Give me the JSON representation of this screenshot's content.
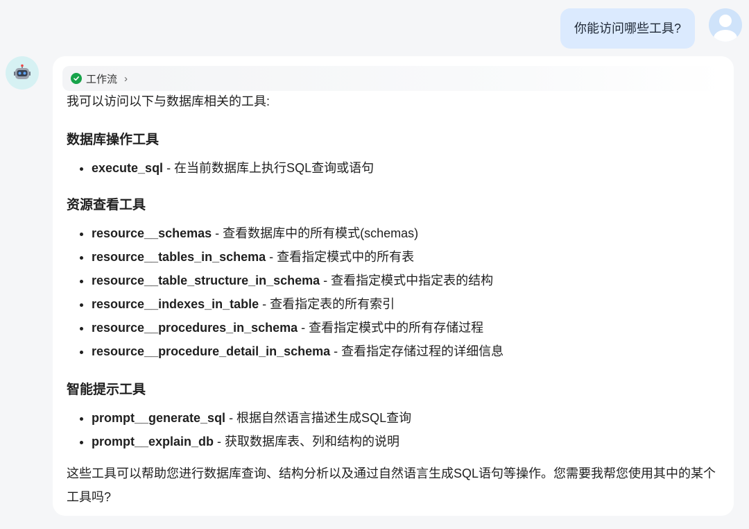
{
  "user_message": "你能访问哪些工具?",
  "workflow_label": "工作流",
  "intro": "我可以访问以下与数据库相关的工具:",
  "sections": [
    {
      "title": "数据库操作工具",
      "items": [
        {
          "name": "execute_sql",
          "desc": " - 在当前数据库上执行SQL查询或语句"
        }
      ]
    },
    {
      "title": "资源查看工具",
      "items": [
        {
          "name": "resource__schemas",
          "desc": " - 查看数据库中的所有模式(schemas)"
        },
        {
          "name": "resource__tables_in_schema",
          "desc": " - 查看指定模式中的所有表"
        },
        {
          "name": "resource__table_structure_in_schema",
          "desc": " - 查看指定模式中指定表的结构"
        },
        {
          "name": "resource__indexes_in_table",
          "desc": " - 查看指定表的所有索引"
        },
        {
          "name": "resource__procedures_in_schema",
          "desc": " - 查看指定模式中的所有存储过程"
        },
        {
          "name": "resource__procedure_detail_in_schema",
          "desc": " - 查看指定存储过程的详细信息"
        }
      ]
    },
    {
      "title": "智能提示工具",
      "items": [
        {
          "name": "prompt__generate_sql",
          "desc": " - 根据自然语言描述生成SQL查询"
        },
        {
          "name": "prompt__explain_db",
          "desc": " - 获取数据库表、列和结构的说明"
        }
      ]
    }
  ],
  "outro": "这些工具可以帮助您进行数据库查询、结构分析以及通过自然语言生成SQL语句等操作。您需要我帮您使用其中的某个工具吗?"
}
